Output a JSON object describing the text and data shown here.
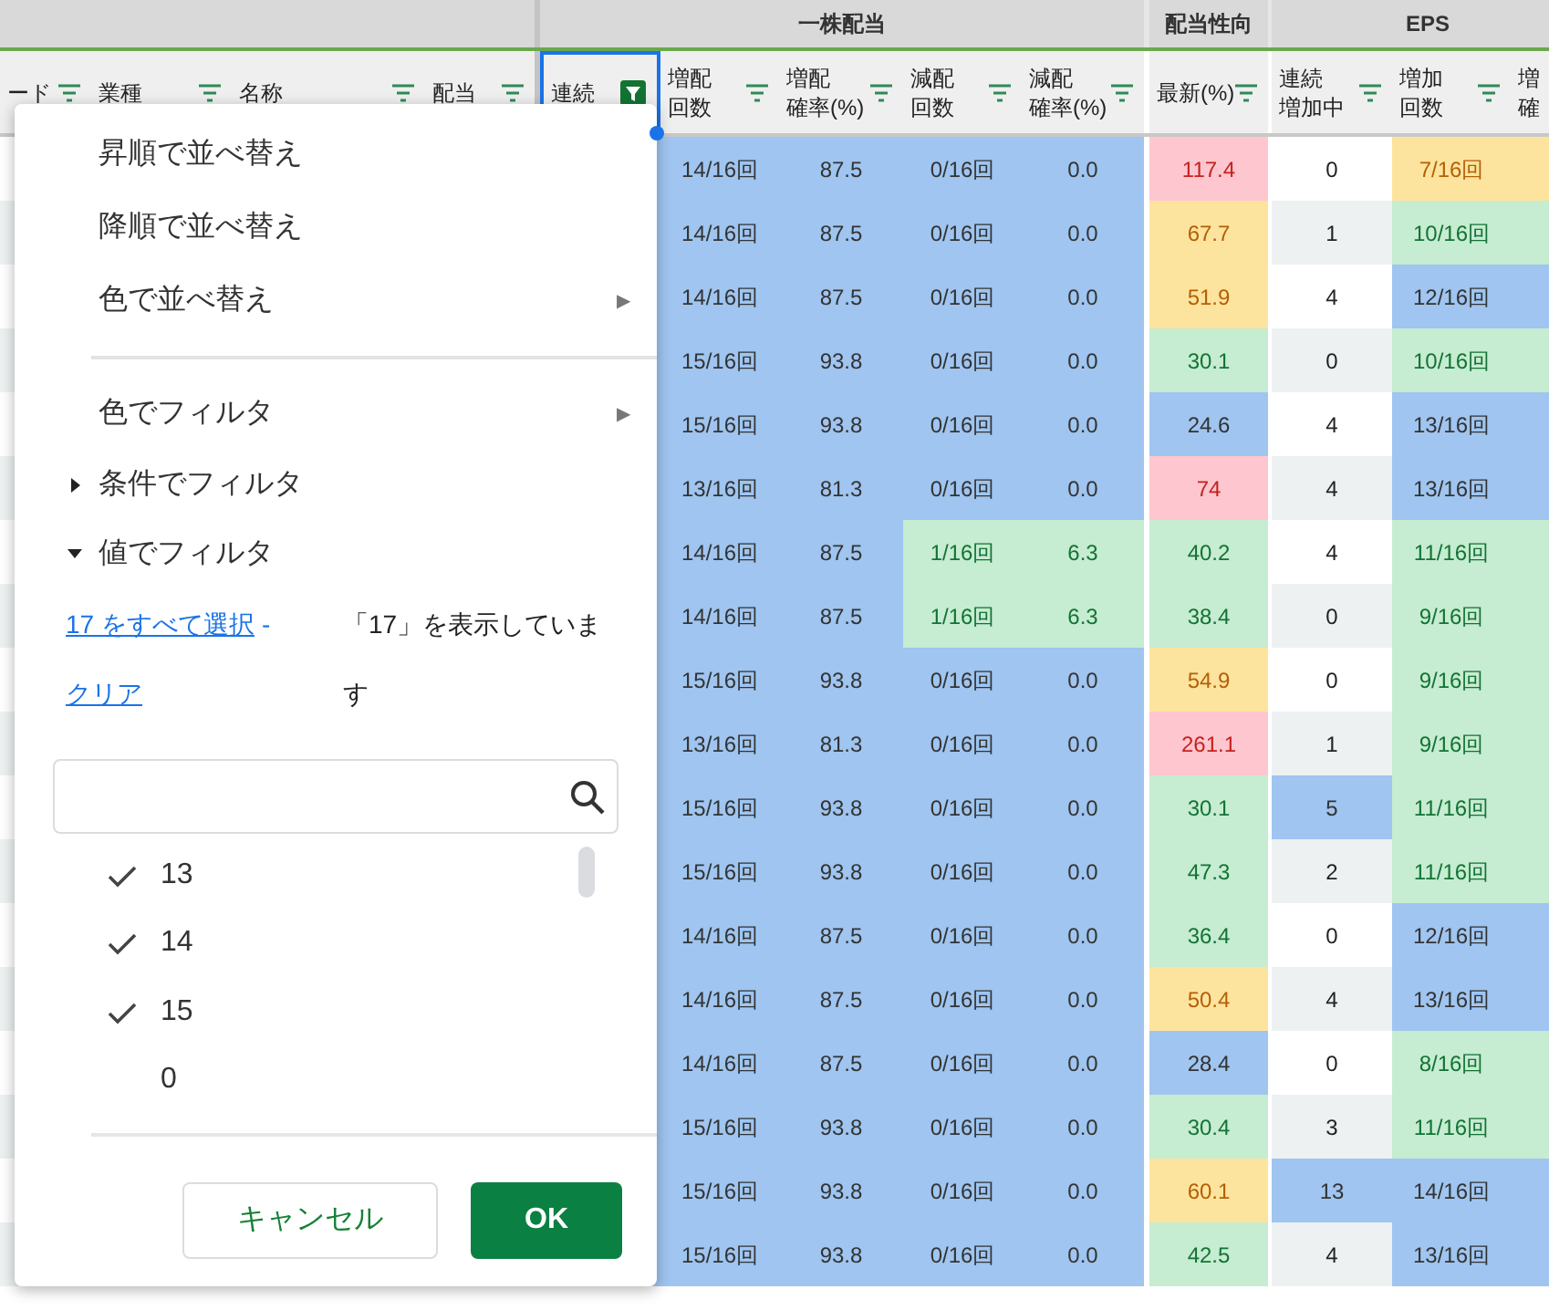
{
  "column_groups": [
    {
      "label": "一株配当"
    },
    {
      "label": "配当性向"
    },
    {
      "label": "EPS"
    }
  ],
  "frozen_columns": [
    {
      "lines": [
        "ード"
      ],
      "filter_active": false
    },
    {
      "lines": [
        "業種"
      ],
      "filter_active": false
    },
    {
      "lines": [
        "名称"
      ],
      "filter_active": false
    },
    {
      "lines": [
        "配当"
      ],
      "filter_active": false
    }
  ],
  "columns": [
    {
      "lines": [
        "連続"
      ],
      "filter_active": true,
      "selected": true
    },
    {
      "lines": [
        "増配",
        "回数"
      ],
      "filter_active": false,
      "selected": false
    },
    {
      "lines": [
        "増配",
        "確率(%)"
      ],
      "filter_active": false,
      "selected": false
    },
    {
      "lines": [
        "減配",
        "回数"
      ],
      "filter_active": false,
      "selected": false
    },
    {
      "lines": [
        "減配",
        "確率(%)"
      ],
      "filter_active": false,
      "selected": false
    },
    {
      "lines": [
        "最新(%)"
      ],
      "filter_active": false,
      "selected": false
    },
    {
      "lines": [
        "連続",
        "増加中"
      ],
      "filter_active": false,
      "selected": false
    },
    {
      "lines": [
        "増加",
        "回数"
      ],
      "filter_active": false,
      "selected": false
    },
    {
      "lines": [
        "増",
        "確"
      ],
      "selected": false
    }
  ],
  "rows": [
    {
      "cells": [
        {
          "text": "14/16回",
          "color": "#9fc5f0"
        },
        {
          "text": "87.5",
          "color": "#9fc5f0"
        },
        {
          "text": "0/16回",
          "color": "#9fc5f0"
        },
        {
          "text": "0.0",
          "color": "#9fc5f0"
        },
        {
          "text": "117.4",
          "color": "#fec6cf"
        },
        {
          "text": "0",
          "color": "#ffffff"
        },
        {
          "text": "7/16回",
          "color": "#fde49e"
        }
      ]
    },
    {
      "cells": [
        {
          "text": "14/16回",
          "color": "#9fc5f0"
        },
        {
          "text": "87.5",
          "color": "#9fc5f0"
        },
        {
          "text": "0/16回",
          "color": "#9fc5f0"
        },
        {
          "text": "0.0",
          "color": "#9fc5f0"
        },
        {
          "text": "67.7",
          "color": "#fde49e"
        },
        {
          "text": "1",
          "color": "#edf1f2"
        },
        {
          "text": "10/16回",
          "color": "#c6ecd2"
        }
      ]
    },
    {
      "cells": [
        {
          "text": "14/16回",
          "color": "#9fc5f0"
        },
        {
          "text": "87.5",
          "color": "#9fc5f0"
        },
        {
          "text": "0/16回",
          "color": "#9fc5f0"
        },
        {
          "text": "0.0",
          "color": "#9fc5f0"
        },
        {
          "text": "51.9",
          "color": "#fde49e"
        },
        {
          "text": "4",
          "color": "#ffffff"
        },
        {
          "text": "12/16回",
          "color": "#9fc5f0"
        }
      ]
    },
    {
      "cells": [
        {
          "text": "15/16回",
          "color": "#9fc5f0"
        },
        {
          "text": "93.8",
          "color": "#9fc5f0"
        },
        {
          "text": "0/16回",
          "color": "#9fc5f0"
        },
        {
          "text": "0.0",
          "color": "#9fc5f0"
        },
        {
          "text": "30.1",
          "color": "#c6ecd2"
        },
        {
          "text": "0",
          "color": "#edf1f2"
        },
        {
          "text": "10/16回",
          "color": "#c6ecd2"
        }
      ]
    },
    {
      "cells": [
        {
          "text": "15/16回",
          "color": "#9fc5f0"
        },
        {
          "text": "93.8",
          "color": "#9fc5f0"
        },
        {
          "text": "0/16回",
          "color": "#9fc5f0"
        },
        {
          "text": "0.0",
          "color": "#9fc5f0"
        },
        {
          "text": "24.6",
          "color": "#9fc5f0"
        },
        {
          "text": "4",
          "color": "#ffffff"
        },
        {
          "text": "13/16回",
          "color": "#9fc5f0"
        }
      ]
    },
    {
      "cells": [
        {
          "text": "13/16回",
          "color": "#9fc5f0"
        },
        {
          "text": "81.3",
          "color": "#9fc5f0"
        },
        {
          "text": "0/16回",
          "color": "#9fc5f0"
        },
        {
          "text": "0.0",
          "color": "#9fc5f0"
        },
        {
          "text": "74",
          "color": "#fec6cf"
        },
        {
          "text": "4",
          "color": "#edf1f2"
        },
        {
          "text": "13/16回",
          "color": "#9fc5f0"
        }
      ]
    },
    {
      "cells": [
        {
          "text": "14/16回",
          "color": "#9fc5f0"
        },
        {
          "text": "87.5",
          "color": "#9fc5f0"
        },
        {
          "text": "1/16回",
          "color": "#c6ecd2"
        },
        {
          "text": "6.3",
          "color": "#c6ecd2"
        },
        {
          "text": "40.2",
          "color": "#c6ecd2"
        },
        {
          "text": "4",
          "color": "#ffffff"
        },
        {
          "text": "11/16回",
          "color": "#c6ecd2"
        }
      ]
    },
    {
      "cells": [
        {
          "text": "14/16回",
          "color": "#9fc5f0"
        },
        {
          "text": "87.5",
          "color": "#9fc5f0"
        },
        {
          "text": "1/16回",
          "color": "#c6ecd2"
        },
        {
          "text": "6.3",
          "color": "#c6ecd2"
        },
        {
          "text": "38.4",
          "color": "#c6ecd2"
        },
        {
          "text": "0",
          "color": "#edf1f2"
        },
        {
          "text": "9/16回",
          "color": "#c6ecd2"
        }
      ]
    },
    {
      "cells": [
        {
          "text": "15/16回",
          "color": "#9fc5f0"
        },
        {
          "text": "93.8",
          "color": "#9fc5f0"
        },
        {
          "text": "0/16回",
          "color": "#9fc5f0"
        },
        {
          "text": "0.0",
          "color": "#9fc5f0"
        },
        {
          "text": "54.9",
          "color": "#fde49e"
        },
        {
          "text": "0",
          "color": "#ffffff"
        },
        {
          "text": "9/16回",
          "color": "#c6ecd2"
        }
      ]
    },
    {
      "cells": [
        {
          "text": "13/16回",
          "color": "#9fc5f0"
        },
        {
          "text": "81.3",
          "color": "#9fc5f0"
        },
        {
          "text": "0/16回",
          "color": "#9fc5f0"
        },
        {
          "text": "0.0",
          "color": "#9fc5f0"
        },
        {
          "text": "261.1",
          "color": "#fec6cf"
        },
        {
          "text": "1",
          "color": "#edf1f2"
        },
        {
          "text": "9/16回",
          "color": "#c6ecd2"
        }
      ]
    },
    {
      "cells": [
        {
          "text": "15/16回",
          "color": "#9fc5f0"
        },
        {
          "text": "93.8",
          "color": "#9fc5f0"
        },
        {
          "text": "0/16回",
          "color": "#9fc5f0"
        },
        {
          "text": "0.0",
          "color": "#9fc5f0"
        },
        {
          "text": "30.1",
          "color": "#c6ecd2"
        },
        {
          "text": "5",
          "color": "#9fc5f0"
        },
        {
          "text": "11/16回",
          "color": "#c6ecd2"
        }
      ]
    },
    {
      "cells": [
        {
          "text": "15/16回",
          "color": "#9fc5f0"
        },
        {
          "text": "93.8",
          "color": "#9fc5f0"
        },
        {
          "text": "0/16回",
          "color": "#9fc5f0"
        },
        {
          "text": "0.0",
          "color": "#9fc5f0"
        },
        {
          "text": "47.3",
          "color": "#c6ecd2"
        },
        {
          "text": "2",
          "color": "#edf1f2"
        },
        {
          "text": "11/16回",
          "color": "#c6ecd2"
        }
      ]
    },
    {
      "cells": [
        {
          "text": "14/16回",
          "color": "#9fc5f0"
        },
        {
          "text": "87.5",
          "color": "#9fc5f0"
        },
        {
          "text": "0/16回",
          "color": "#9fc5f0"
        },
        {
          "text": "0.0",
          "color": "#9fc5f0"
        },
        {
          "text": "36.4",
          "color": "#c6ecd2"
        },
        {
          "text": "0",
          "color": "#ffffff"
        },
        {
          "text": "12/16回",
          "color": "#9fc5f0"
        }
      ]
    },
    {
      "cells": [
        {
          "text": "14/16回",
          "color": "#9fc5f0"
        },
        {
          "text": "87.5",
          "color": "#9fc5f0"
        },
        {
          "text": "0/16回",
          "color": "#9fc5f0"
        },
        {
          "text": "0.0",
          "color": "#9fc5f0"
        },
        {
          "text": "50.4",
          "color": "#fde49e"
        },
        {
          "text": "4",
          "color": "#edf1f2"
        },
        {
          "text": "13/16回",
          "color": "#9fc5f0"
        }
      ]
    },
    {
      "cells": [
        {
          "text": "14/16回",
          "color": "#9fc5f0"
        },
        {
          "text": "87.5",
          "color": "#9fc5f0"
        },
        {
          "text": "0/16回",
          "color": "#9fc5f0"
        },
        {
          "text": "0.0",
          "color": "#9fc5f0"
        },
        {
          "text": "28.4",
          "color": "#9fc5f0"
        },
        {
          "text": "0",
          "color": "#ffffff"
        },
        {
          "text": "8/16回",
          "color": "#c6ecd2"
        }
      ]
    },
    {
      "cells": [
        {
          "text": "15/16回",
          "color": "#9fc5f0"
        },
        {
          "text": "93.8",
          "color": "#9fc5f0"
        },
        {
          "text": "0/16回",
          "color": "#9fc5f0"
        },
        {
          "text": "0.0",
          "color": "#9fc5f0"
        },
        {
          "text": "30.4",
          "color": "#c6ecd2"
        },
        {
          "text": "3",
          "color": "#edf1f2"
        },
        {
          "text": "11/16回",
          "color": "#c6ecd2"
        }
      ]
    },
    {
      "cells": [
        {
          "text": "15/16回",
          "color": "#9fc5f0"
        },
        {
          "text": "93.8",
          "color": "#9fc5f0"
        },
        {
          "text": "0/16回",
          "color": "#9fc5f0"
        },
        {
          "text": "0.0",
          "color": "#9fc5f0"
        },
        {
          "text": "60.1",
          "color": "#fde49e"
        },
        {
          "text": "13",
          "color": "#9fc5f0"
        },
        {
          "text": "14/16回",
          "color": "#9fc5f0"
        }
      ]
    },
    {
      "cells": [
        {
          "text": "15/16回",
          "color": "#9fc5f0"
        },
        {
          "text": "93.8",
          "color": "#9fc5f0"
        },
        {
          "text": "0/16回",
          "color": "#9fc5f0"
        },
        {
          "text": "0.0",
          "color": "#9fc5f0"
        },
        {
          "text": "42.5",
          "color": "#c6ecd2"
        },
        {
          "text": "4",
          "color": "#edf1f2"
        },
        {
          "text": "13/16回",
          "color": "#9fc5f0"
        }
      ]
    }
  ],
  "filter_menu": {
    "items": [
      {
        "kind": "action",
        "label": "昇順で並べ替え"
      },
      {
        "kind": "action",
        "label": "降順で並べ替え"
      },
      {
        "kind": "submenu",
        "label": "色で並べ替え",
        "arrow": "▶"
      },
      {
        "kind": "divider"
      },
      {
        "kind": "submenu",
        "label": "色でフィルタ",
        "arrow": "▶"
      },
      {
        "kind": "section",
        "label": "条件でフィルタ",
        "expanded": false
      },
      {
        "kind": "section",
        "label": "値でフィルタ",
        "expanded": true
      }
    ],
    "select_all_link": "17 をすべて選択",
    "separator": "-",
    "clear_link": "クリア",
    "status": "「17」を表示しています",
    "values": [
      {
        "label": "13",
        "checked": true
      },
      {
        "label": "14",
        "checked": true
      },
      {
        "label": "15",
        "checked": true
      },
      {
        "label": "0",
        "checked": false
      }
    ],
    "buttons": [
      {
        "label": "キャンセル",
        "kind": "secondary"
      },
      {
        "label": "OK",
        "kind": "primary"
      }
    ]
  }
}
